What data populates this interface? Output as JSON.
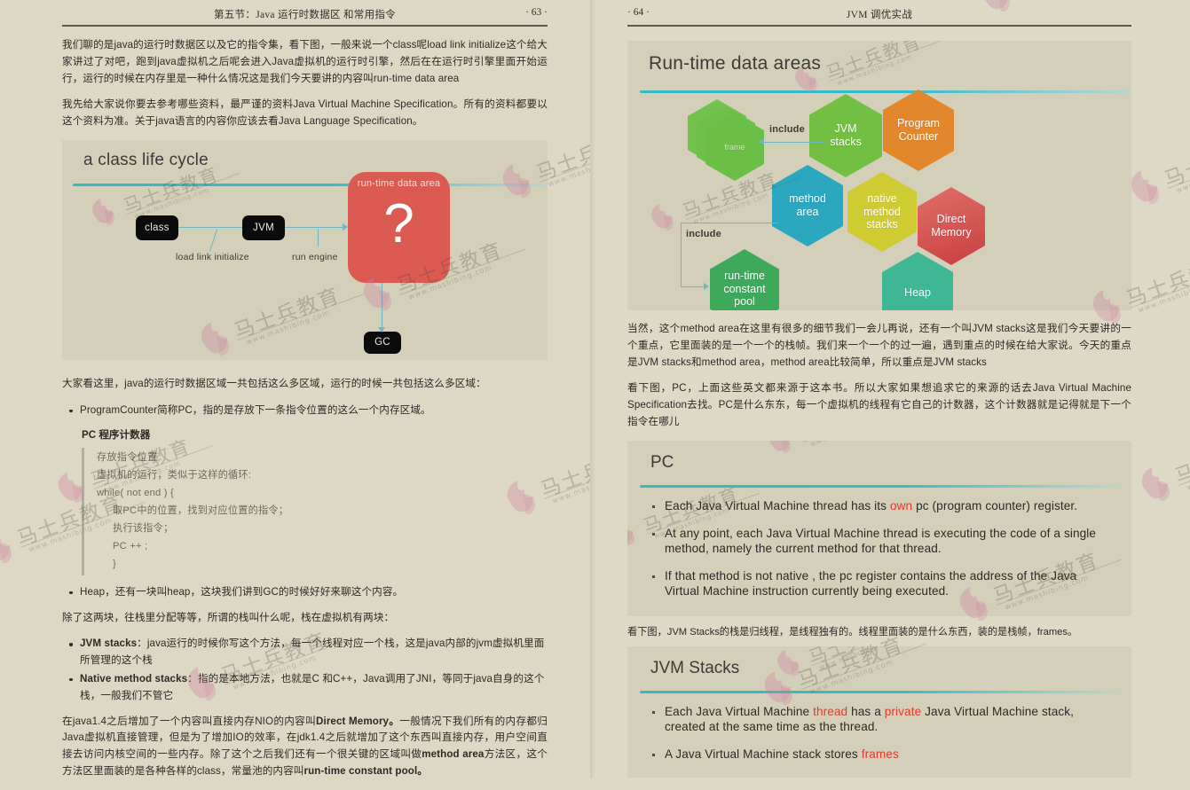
{
  "watermark": {
    "text": "马士兵教育",
    "url": "www.mashibing.com",
    "color": "#c9789a"
  },
  "left_page": {
    "runhead": {
      "title": "第五节：Java 运行时数据区 和常用指令",
      "page_number": "· 63 ·"
    },
    "paragraphs": {
      "p1": "我们聊的是java的运行时数据区以及它的指令集，看下图，一般来说一个class呢load link initialize这个给大家讲过了对吧，跑到java虚拟机之后呢会进入Java虚拟机的运行时引擎，然后在在运行时引擎里面开始运行，运行的时候在内存里是一种什么情况这是我们今天要讲的内容叫run-time data area",
      "p2": "我先给大家说你要去参考哪些资料，最严谨的资料Java Virtual Machine Specification。所有的资料都要以这个资料为准。关于java语言的内容你应该去看Java Language Specification。",
      "p3": "大家看这里，java的运行时数据区域一共包括这么多区域，运行的时候一共包括这么多区域：",
      "p4": "除了这两块，往栈里分配等等，所谓的栈叫什么呢，栈在虚拟机有两块：",
      "p5_a": "在java1.4之后增加了一个内容叫直接内存NIO的内容叫",
      "p5_b1": "Direct Memory。",
      "p5_c": "一般情况下我们所有的内存都归Java虚拟机直接管理，但是为了增加IO的效率，在jdk1.4之后就增加了这个东西叫直接内存，用户空间直接去访问内核空间的一些内存。除了这个之后我们还有一个很关键的区域叫做",
      "p5_b2": "method area",
      "p5_d": "方法区，这个方法区里面装的是各种各样的class，常量池的内容叫",
      "p5_b3": "run-time constant pool。"
    },
    "bullets": {
      "pc": "ProgramCounter简称PC，指的是存放下一条指令位置的这么一个内存区域。",
      "pc_label": "PC 程序计数器",
      "heap": "Heap，还有一块叫heap，这块我们讲到GC的时候好好来聊这个内容。",
      "jvm_stacks_bold": "JVM stacks",
      "jvm_stacks_rest": "：java运行的时候你写这个方法，每一个线程对应一个栈，这是java内部的jvm虚拟机里面所管理的这个栈",
      "native_bold": "Native method stacks",
      "native_rest": "：指的是本地方法，也就是C 和C++，Java调用了JNI，等同于java自身的这个栈，一般我们不管它"
    },
    "code_block": [
      "存放指令位置",
      "虚拟机的运行，类似于这样的循环:",
      "while( not end ) {",
      "取PC中的位置，找到对应位置的指令；",
      "执行该指令；",
      "PC ++ ;",
      "}"
    ],
    "slide": {
      "title": "a class life cycle",
      "boxes": {
        "class": "class",
        "jvm": "JVM",
        "gc": "GC"
      },
      "panel": {
        "caption": "run-time data area",
        "glyph": "?"
      },
      "labels": {
        "load": "load link initialize",
        "engine": "run engine"
      },
      "colors": {
        "panel": "#db5b53",
        "box": "#0b0b0b",
        "connector": "#6fb6bf",
        "slide_bg": "#d4cfb8"
      }
    }
  },
  "right_page": {
    "runhead": {
      "title": "JVM 调优实战",
      "page_number": "· 64 ·"
    },
    "slide_rtda": {
      "title": "Run-time data areas",
      "connectors": {
        "include_top": "include",
        "include_left": "include"
      },
      "hexagons": [
        {
          "id": "frame",
          "label": "frame",
          "color": "#6fc04a"
        },
        {
          "id": "jvm",
          "label": "JVM\nstacks",
          "color": "#72bf44"
        },
        {
          "id": "pc",
          "label": "Program\nCounter",
          "color": "#e2872c"
        },
        {
          "id": "method",
          "label": "method\narea",
          "color": "#2ba7bf"
        },
        {
          "id": "native",
          "label": "native\nmethod\nstacks",
          "color": "#cfcc33"
        },
        {
          "id": "direct",
          "label": "Direct\nMemory",
          "color": "#d4544f"
        },
        {
          "id": "rtcp",
          "label": "run-time\nconstant\npool",
          "color": "#3fa95b"
        },
        {
          "id": "heap",
          "label": "Heap",
          "color": "#3fb795"
        }
      ]
    },
    "paragraphs": {
      "p1": "当然，这个method area在这里有很多的细节我们一会儿再说，还有一个叫JVM stacks这是我们今天要讲的一个重点，它里面装的是一个一个的栈帧。我们来一个一个的过一遍，遇到重点的时候在给大家说。今天的重点是JVM stacks和method area，method area比较简单，所以重点是JVM stacks",
      "p2": "看下图，PC，上面这些英文都来源于这本书。所以大家如果想追求它的来源的话去Java Virtual Machine Specification去找。PC是什么东东，每一个虚拟机的线程有它自己的计数器，这个计数器就是记得就是下一个指令在哪儿",
      "p3": "看下图，JVM Stacks的栈是归线程，是线程独有的。线程里面装的是什么东西，装的是栈帧，frames。"
    },
    "slide_pc": {
      "title": "PC",
      "bullets": [
        {
          "pre": "Each Java Virtual Machine thread has its ",
          "hl": "own",
          "post": "  pc (program counter) register."
        },
        {
          "pre": "At any point, each Java Virtual Machine thread is executing the code of a single method, namely the current method  for that thread.",
          "hl": "",
          "post": ""
        },
        {
          "pre": "If that method is not native , the  pc register contains the address of the Java Virtual Machine instruction currently being executed.",
          "hl": "",
          "post": ""
        }
      ]
    },
    "slide_jvms": {
      "title": "JVM Stacks",
      "bullets": [
        {
          "pre": "Each Java Virtual Machine ",
          "hl": "thread",
          "mid": " has a ",
          "hl2": "private",
          "post": " Java Virtual Machine stack, created at the same time as the thread."
        },
        {
          "pre": "A Java Virtual Machine stack stores ",
          "hl": "frames",
          "mid": "",
          "hl2": "",
          "post": ""
        }
      ]
    }
  }
}
